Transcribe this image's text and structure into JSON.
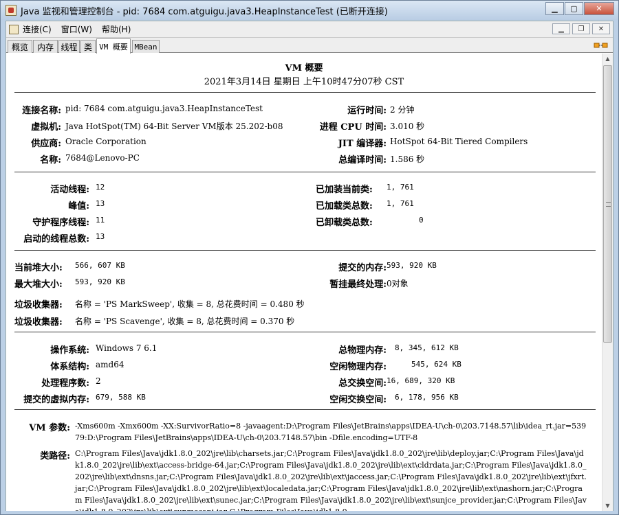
{
  "window": {
    "title": "Java 监视和管理控制台 - pid: 7684 com.atguigu.java3.HeapInstanceTest (已断开连接)",
    "buttons": [
      "▁",
      "▢",
      "✕"
    ]
  },
  "menubar": {
    "items": [
      "连接(C)",
      "窗口(W)",
      "帮助(H)"
    ],
    "mdi_buttons": [
      "▁",
      "❐",
      "✕"
    ]
  },
  "tabs": [
    "概览",
    "内存",
    "线程",
    "类",
    "VM 概要",
    "MBean"
  ],
  "header": {
    "title": "VM 概要",
    "date": "2021年3月14日 星期日 上午10时47分07秒 CST"
  },
  "section1": {
    "left": [
      {
        "label": "连接名称:",
        "value": "pid: 7684 com.atguigu.java3.HeapInstanceTest"
      },
      {
        "label": "虚拟机:",
        "value": "Java HotSpot(TM) 64-Bit Server VM版本 25.202-b08"
      },
      {
        "label": "供应商:",
        "value": "Oracle Corporation"
      },
      {
        "label": "名称:",
        "value": "7684@Lenovo-PC"
      }
    ],
    "right": [
      {
        "label": "运行时间:",
        "value": "2 分钟"
      },
      {
        "label": "进程 CPU 时间:",
        "value": "3.010 秒"
      },
      {
        "label": "JIT 编译器:",
        "value": "HotSpot 64-Bit Tiered Compilers"
      },
      {
        "label": "总编译时间:",
        "value": "1.586 秒"
      }
    ]
  },
  "section2": {
    "left": [
      {
        "label": "活动线程:",
        "value": "12"
      },
      {
        "label": "峰值:",
        "value": "13"
      },
      {
        "label": "守护程序线程:",
        "value": "11"
      },
      {
        "label": "启动的线程总数:",
        "value": "13"
      }
    ],
    "right": [
      {
        "label": "已加装当前类:",
        "value": "1, 761"
      },
      {
        "label": "已加载类总数:",
        "value": "1, 761"
      },
      {
        "label": "已卸载类总数:",
        "value": "0"
      }
    ]
  },
  "section3": {
    "left": [
      {
        "label": "当前堆大小:",
        "value": "566, 607 KB"
      },
      {
        "label": "最大堆大小:",
        "value": "593, 920 KB"
      }
    ],
    "right": [
      {
        "label": "提交的内存:",
        "value": "593, 920 KB"
      },
      {
        "label": "暂挂最终处理:",
        "value": "0对象"
      }
    ],
    "gc": [
      {
        "label": "垃圾收集器:",
        "value": "名称 = 'PS MarkSweep', 收集 = 8, 总花费时间 = 0.480 秒"
      },
      {
        "label": "垃圾收集器:",
        "value": "名称 = 'PS Scavenge', 收集 = 8, 总花费时间 = 0.370 秒"
      }
    ]
  },
  "section4": {
    "left": [
      {
        "label": "操作系统:",
        "value": "Windows 7 6.1"
      },
      {
        "label": "体系结构:",
        "value": "amd64"
      },
      {
        "label": "处理程序数:",
        "value": "2"
      },
      {
        "label": "提交的虚拟内存:",
        "value": "679, 588 KB"
      }
    ],
    "right": [
      {
        "label": "总物理内存:",
        "value": "8, 345, 612 KB"
      },
      {
        "label": "空闲物理内存:",
        "value": "545, 624 KB"
      },
      {
        "label": "总交换空间:",
        "value": "16, 689, 320 KB"
      },
      {
        "label": "空闲交换空间:",
        "value": "6, 178, 956 KB"
      }
    ]
  },
  "section5": {
    "vm_args_label": "VM 参数:",
    "vm_args": "-Xms600m -Xmx600m -XX:SurvivorRatio=8 -javaagent:D:\\Program Files\\JetBrains\\apps\\IDEA-U\\ch-0\\203.7148.57\\lib\\idea_rt.jar=53979:D:\\Program Files\\JetBrains\\apps\\IDEA-U\\ch-0\\203.7148.57\\bin -Dfile.encoding=UTF-8",
    "classpath_label": "类路径:",
    "classpath": "C:\\Program Files\\Java\\jdk1.8.0_202\\jre\\lib\\charsets.jar;C:\\Program Files\\Java\\jdk1.8.0_202\\jre\\lib\\deploy.jar;C:\\Program Files\\Java\\jdk1.8.0_202\\jre\\lib\\ext\\access-bridge-64.jar;C:\\Program Files\\Java\\jdk1.8.0_202\\jre\\lib\\ext\\cldrdata.jar;C:\\Program Files\\Java\\jdk1.8.0_202\\jre\\lib\\ext\\dnsns.jar;C:\\Program Files\\Java\\jdk1.8.0_202\\jre\\lib\\ext\\jaccess.jar;C:\\Program Files\\Java\\jdk1.8.0_202\\jre\\lib\\ext\\jfxrt.jar;C:\\Program Files\\Java\\jdk1.8.0_202\\jre\\lib\\ext\\localedata.jar;C:\\Program Files\\Java\\jdk1.8.0_202\\jre\\lib\\ext\\nashorn.jar;C:\\Program Files\\Java\\jdk1.8.0_202\\jre\\lib\\ext\\sunec.jar;C:\\Program Files\\Java\\jdk1.8.0_202\\jre\\lib\\ext\\sunjce_provider.jar;C:\\Program Files\\Java\\jdk1.8.0_202\\jre\\lib\\ext\\sunmscapi.jar;C:\\Program Files\\Java\\jdk1.8.0"
  }
}
